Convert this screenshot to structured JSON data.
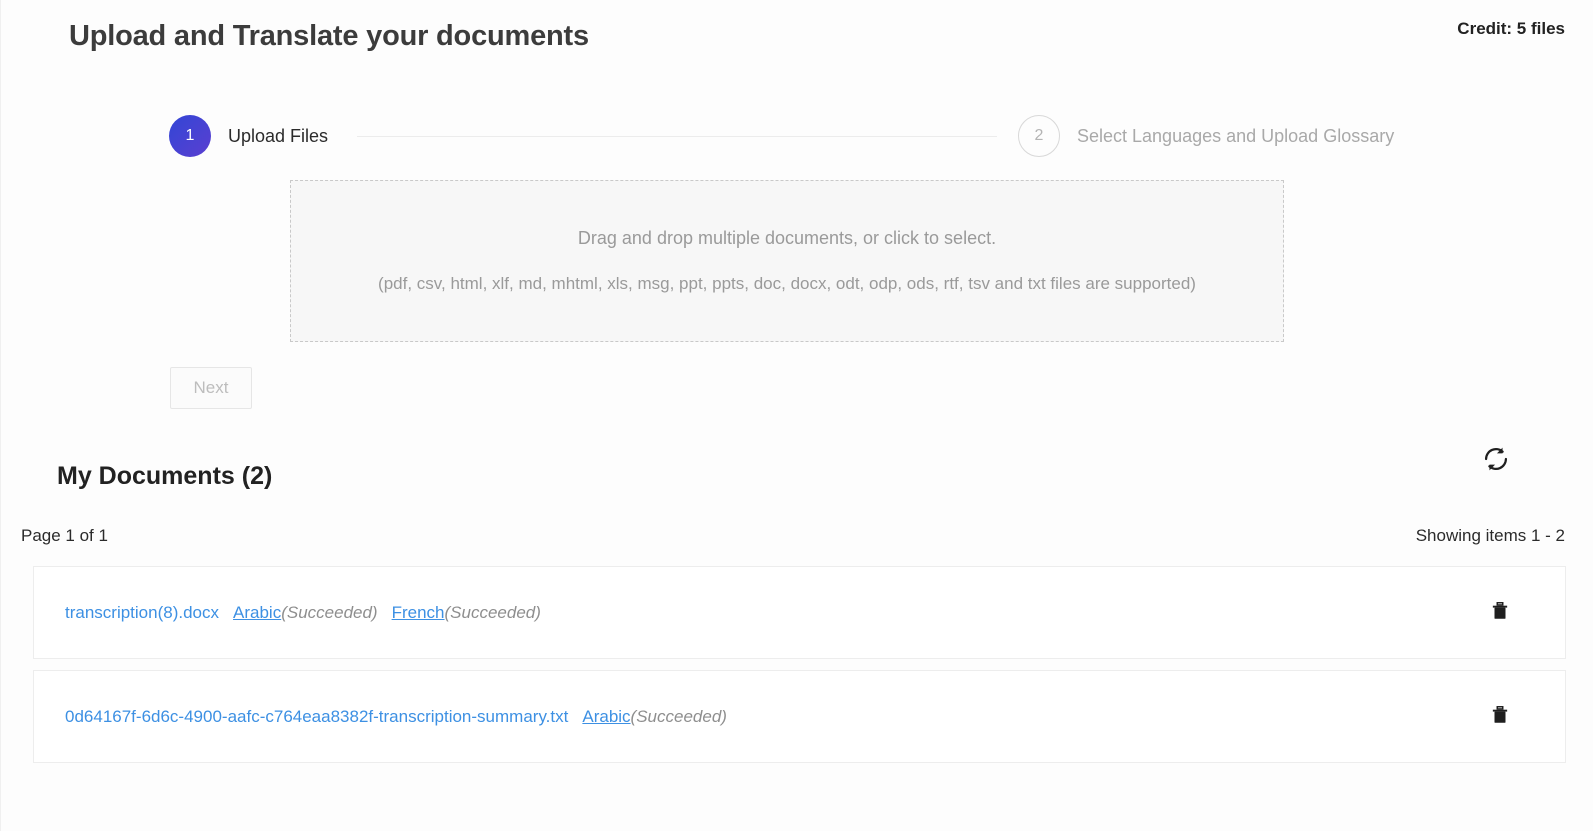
{
  "header": {
    "title": "Upload and Translate your documents",
    "credit": "Credit: 5 files"
  },
  "stepper": {
    "steps": [
      {
        "number": "1",
        "label": "Upload Files",
        "state": "active"
      },
      {
        "number": "2",
        "label": "Select Languages and Upload Glossary",
        "state": "inactive"
      }
    ]
  },
  "dropzone": {
    "primary_text": "Drag and drop multiple documents, or click to select.",
    "secondary_text": "(pdf, csv, html, xlf, md, mhtml, xls, msg, ppt, ppts, doc, docx, odt, odp, ods, rtf, tsv and txt files are supported)"
  },
  "actions": {
    "next_label": "Next"
  },
  "documents_section": {
    "title": "My Documents (2)",
    "refresh_icon": "refresh-icon",
    "page_info": "Page 1 of 1",
    "showing_info": "Showing items 1 - 2",
    "delete_icon": "trash-icon",
    "items": [
      {
        "name": "transcription(8).docx",
        "languages": [
          {
            "language": "Arabic",
            "status": "(Succeeded)"
          },
          {
            "language": "French",
            "status": "(Succeeded)"
          }
        ]
      },
      {
        "name": "0d64167f-6d6c-4900-aafc-c764eaa8382f-transcription-summary.txt",
        "languages": [
          {
            "language": "Arabic",
            "status": "(Succeeded)"
          }
        ]
      }
    ]
  },
  "colors": {
    "link": "#3d90e3",
    "step_active": "#3246d6",
    "page_bg": "#fdfdfd",
    "muted_text": "#9a9a9a"
  }
}
